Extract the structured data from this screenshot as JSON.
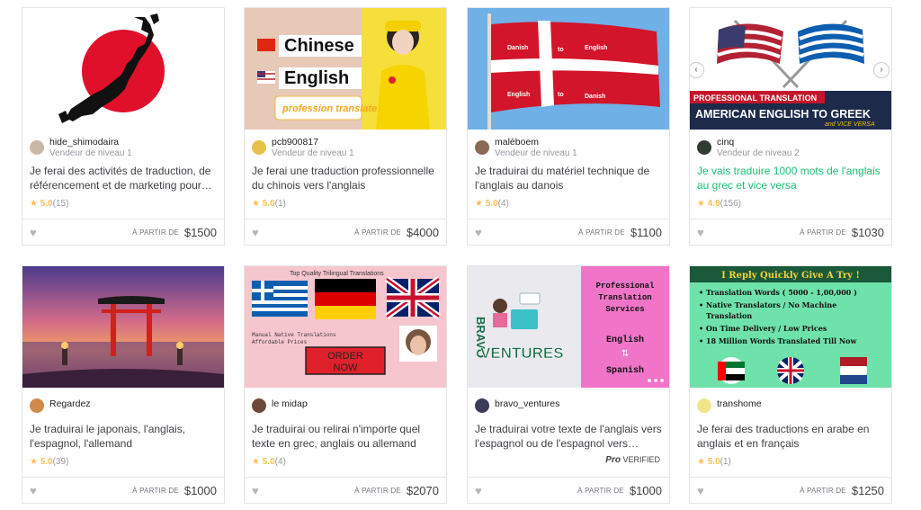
{
  "gigs": [
    {
      "seller_name": "hide_shimodaira",
      "seller_level": "Vendeur de niveau 1",
      "title": "Je ferai des activités de traduction, de référencement et de marketing pour…",
      "rating": "5.0",
      "reviews": "(15)",
      "price_label": "À PARTIR DE",
      "price": "$1500",
      "avatar_color": "#c9b8a8"
    },
    {
      "seller_name": "pcb900817",
      "seller_level": "Vendeur de niveau 1",
      "title": "Je ferai une traduction professionnelle du chinois vers l'anglais",
      "rating": "5.0",
      "reviews": "(1)",
      "price_label": "À PARTIR DE",
      "price": "$4000",
      "avatar_color": "#e6c24a",
      "thumb_text": {
        "line1": "Chinese",
        "line2": "English",
        "line3": "profession translate"
      }
    },
    {
      "seller_name": "maléboem",
      "seller_level": "Vendeur de niveau 1",
      "title": "Je traduirai du matériel technique de l'anglais au danois",
      "rating": "5.0",
      "reviews": "(4)",
      "price_label": "À PARTIR DE",
      "price": "$1100",
      "avatar_color": "#8a6a55",
      "thumb_text": {
        "a": "Danish",
        "b": "to",
        "c": "English",
        "d": "English",
        "e": "to",
        "f": "Danish"
      }
    },
    {
      "seller_name": "cinq",
      "seller_level": "Vendeur de niveau 2",
      "title": "Je vais traduire 1000 mots de l'anglais au grec et vice versa",
      "rating": "4.9",
      "reviews": "(156)",
      "price_label": "À PARTIR DE",
      "price": "$1030",
      "avatar_color": "#2f3b33",
      "thumb_text": {
        "banner": "PROFESSIONAL TRANSLATION",
        "main": "AMERICAN ENGLISH TO GREEK",
        "sub": "and VICE VERSA"
      }
    },
    {
      "seller_name": "Regardez",
      "seller_level": "",
      "title": "Je traduirai le japonais, l'anglais, l'espagnol, l'allemand",
      "rating": "5.0",
      "reviews": "(39)",
      "price_label": "À PARTIR DE",
      "price": "$1000",
      "avatar_color": "#d08a4a"
    },
    {
      "seller_name": "le midap",
      "seller_level": "",
      "title": "Je traduirai ou relirai n'importe quel texte en grec, anglais ou allemand",
      "rating": "5.0",
      "reviews": "(4)",
      "price_label": "À PARTIR DE",
      "price": "$2070",
      "avatar_color": "#6b4a3a",
      "thumb_text": {
        "top": "Top Quality Trilingual Translations",
        "manual": "Manual Native Translations",
        "afford": "Affordable Prices",
        "order1": "ORDER",
        "order2": "NOW"
      }
    },
    {
      "seller_name": "bravo_ventures",
      "seller_level": "",
      "title": "Je traduirai votre texte de l'anglais vers l'espagnol ou de l'espagnol vers…",
      "rating": "",
      "reviews": "",
      "price_label": "À PARTIR DE",
      "price": "$1000",
      "avatar_color": "#3b3b5a",
      "pro_a": "Pro",
      "pro_b": "VERIFIED",
      "thumb_text": {
        "bravo": "BRAVO",
        "ventures": "VENTURES",
        "p1": "Professional",
        "p2": "Translation",
        "p3": "Services",
        "en": "English",
        "es": "Spanish"
      }
    },
    {
      "seller_name": "transhome",
      "seller_level": "",
      "title": "Je ferai des traductions en arabe en anglais et en français",
      "rating": "5.0",
      "reviews": "(1)",
      "price_label": "À PARTIR DE",
      "price": "$1250",
      "avatar_color": "#f2e48a",
      "thumb_text": {
        "head": "I Reply Quickly Give A Try !",
        "b1": "Translation Words ( 5000 - 1,00,000 )",
        "b2": "Native Translators / No Machine",
        "b2b": "Translation",
        "b3": "On Time Delivery / Low Prices",
        "b4": "18 Million Words Translated Till Now"
      }
    }
  ]
}
